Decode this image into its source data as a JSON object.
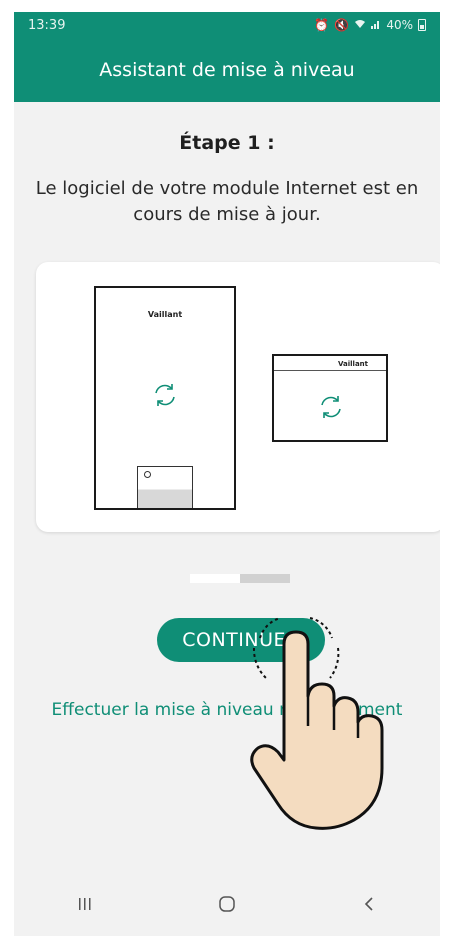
{
  "status_bar": {
    "time": "13:39",
    "battery": "40%"
  },
  "app_bar": {
    "title": "Assistant de mise à niveau"
  },
  "step": {
    "title": "Étape 1 :",
    "description": "Le logiciel de votre module Internet est en cours de mise à jour."
  },
  "illustration": {
    "boiler_brand": "Vaillant",
    "module_brand": "Vaillant"
  },
  "pager": {
    "current": 1,
    "total": 2
  },
  "actions": {
    "continue_label": "CONTINUER",
    "manual_link": "Effectuer la mise à niveau manuellement"
  },
  "colors": {
    "accent": "#0f8e76",
    "background": "#f2f2f2"
  },
  "icons": [
    "alarm-icon",
    "mute-icon",
    "wifi-icon",
    "signal-icon",
    "battery-icon",
    "sync-icon",
    "recent-apps-icon",
    "home-icon",
    "back-icon"
  ]
}
